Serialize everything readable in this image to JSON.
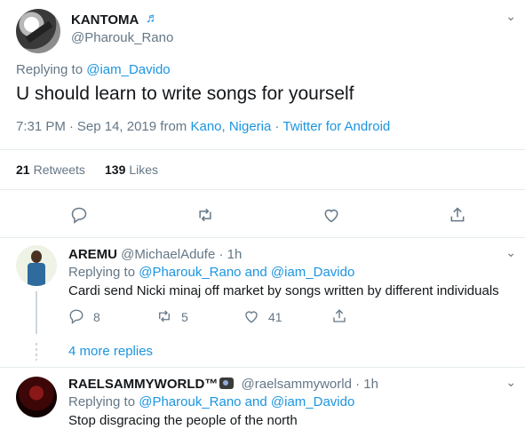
{
  "main_tweet": {
    "display_name": "KANTOMA",
    "name_emoji": "♬",
    "handle": "@Pharouk_Rano",
    "replying_prefix": "Replying to",
    "replying_to": "@iam_Davido",
    "text": "U should learn to write songs for yourself",
    "time": "7:31 PM",
    "dot": "·",
    "date": "Sep 14, 2019",
    "from_label": "from",
    "location": "Kano, Nigeria",
    "dot2": "·",
    "client": "Twitter for Android",
    "retweets_count": "21",
    "retweets_label": "Retweets",
    "likes_count": "139",
    "likes_label": "Likes",
    "chevron": "⌄"
  },
  "replies": [
    {
      "display_name": "AREMU",
      "handle": "@MichaelAdufe",
      "dot": "·",
      "time": "1h",
      "replying_prefix": "Replying to",
      "replying_to": "@Pharouk_Rano and @iam_Davido",
      "text": "Cardi send Nicki minaj off market by songs written by different individuals",
      "reply_count": "8",
      "retweet_count": "5",
      "like_count": "41",
      "more_replies": "4 more replies",
      "chevron": "⌄"
    },
    {
      "display_name": "RAELSAMMYWORLD™",
      "handle": "@raelsammyworld",
      "dot": "·",
      "time": "1h",
      "replying_prefix": "Replying to",
      "replying_to": "@Pharouk_Rano and @iam_Davido",
      "text": "Stop disgracing the people of the north",
      "chevron": "⌄"
    }
  ],
  "colors": {
    "link_blue": "#1b95e0",
    "secondary_grey": "#657786",
    "divider": "#e6ecf0"
  }
}
